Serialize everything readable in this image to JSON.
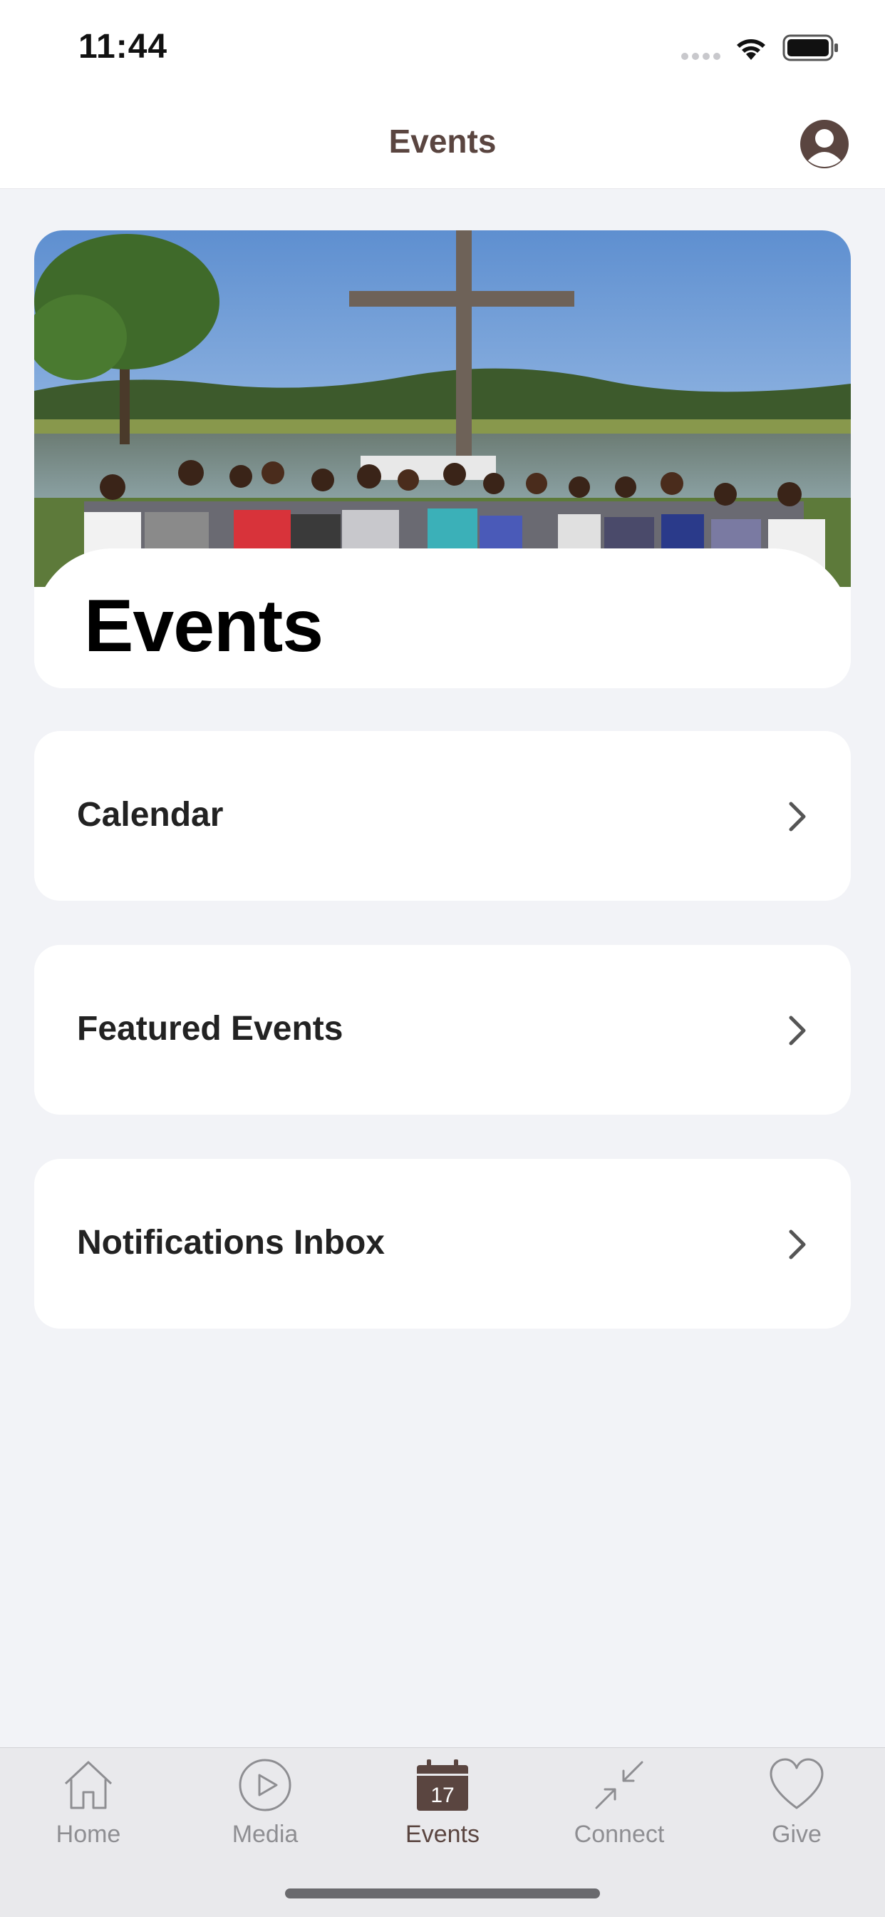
{
  "status_bar": {
    "time": "11:44"
  },
  "nav": {
    "title": "Events"
  },
  "hero": {
    "title": "Events"
  },
  "menu": [
    {
      "label": "Calendar"
    },
    {
      "label": "Featured Events"
    },
    {
      "label": "Notifications Inbox"
    }
  ],
  "tabs": [
    {
      "label": "Home",
      "icon": "home-icon"
    },
    {
      "label": "Media",
      "icon": "play-icon"
    },
    {
      "label": "Events",
      "icon": "calendar-icon",
      "badge": "17",
      "active": true
    },
    {
      "label": "Connect",
      "icon": "connect-arrows-icon"
    },
    {
      "label": "Give",
      "icon": "heart-icon"
    }
  ],
  "colors": {
    "accent": "#5a4540",
    "background": "#f2f3f7",
    "tab_inactive": "#8e8e92"
  }
}
